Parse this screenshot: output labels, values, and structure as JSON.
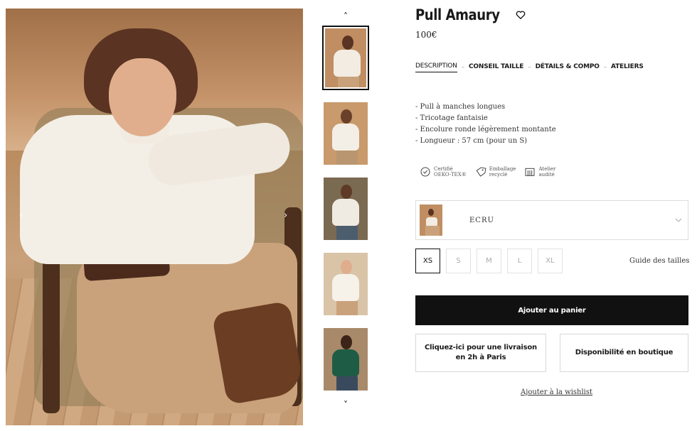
{
  "product": {
    "title": "Pull Amaury",
    "price": "100€"
  },
  "tabs": [
    {
      "label": "DESCRIPTION",
      "active": true
    },
    {
      "label": "CONSEIL TAILLE",
      "active": false
    },
    {
      "label": "DÉTAILS & COMPO",
      "active": false
    },
    {
      "label": "ATELIERS",
      "active": false
    }
  ],
  "tab_separator": "–",
  "description": [
    "- Pull à manches longues",
    "- Tricotage fantaisie",
    "- Encolure ronde légèrement montante",
    "- Longueur : 57 cm (pour un S)"
  ],
  "badges": [
    {
      "icon": "certified-check-icon",
      "line1": "Certifié",
      "line2": "OEKO-TEX®"
    },
    {
      "icon": "recycled-tag-icon",
      "line1": "Emballage",
      "line2": "recyclé"
    },
    {
      "icon": "workshop-audit-icon",
      "line1": "Atelier",
      "line2": "audité"
    }
  ],
  "color": {
    "selected": "ECRU"
  },
  "sizes": [
    "XS",
    "S",
    "M",
    "L",
    "XL"
  ],
  "selected_size": "XS",
  "size_guide": "Guide des tailles",
  "add_to_cart": "Ajouter au panier",
  "delivery_button": "Cliquez-ici pour une livraison en 2h à Paris",
  "store_availability": "Disponibilité en boutique",
  "wishlist": "Ajouter à la wishlist",
  "gallery": {
    "prev_arrow": "‹",
    "next_arrow": "›",
    "thumb_up": "˄",
    "thumb_down": "˅",
    "thumbnail_count": 5,
    "selected_index": 0
  },
  "colors": {
    "primary_button": "#111111",
    "text": "#1a1a1a",
    "border": "#dddddd"
  }
}
